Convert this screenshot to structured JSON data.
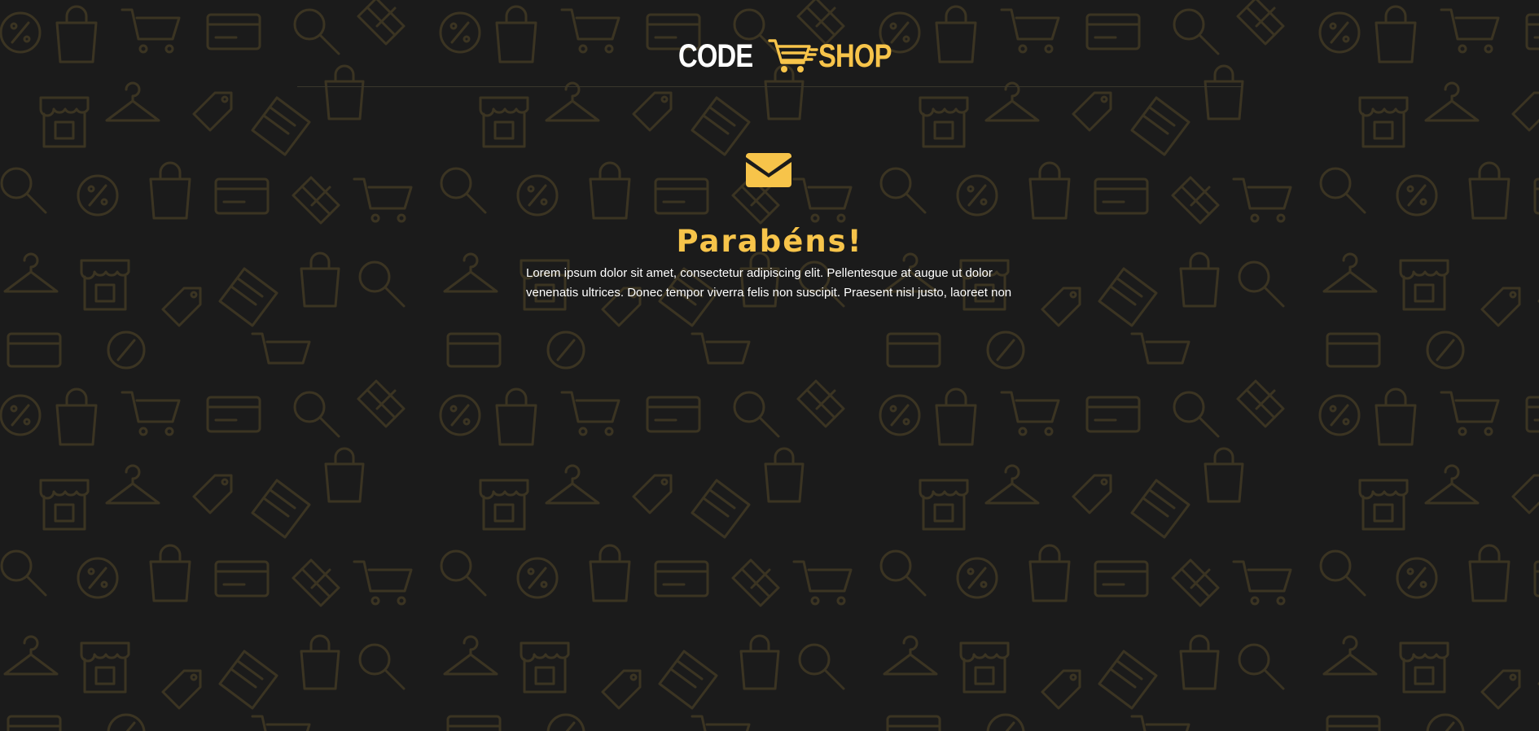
{
  "brand": {
    "word_left": "CODE",
    "word_right": "SHOP",
    "icon": "shopping-cart-icon"
  },
  "message": {
    "icon": "envelope-icon",
    "title": "Parabéns!",
    "lines": [
      "Lorem ipsum dolor sit amet, consectetur adipiscing elit. Pellentesque at augue ut dolor",
      "venenatis ultrices. Donec tempor viverra felis non suscipit. Praesent nisl justo, laoreet non"
    ]
  },
  "background": {
    "pattern_icons": [
      "shopping-bag-icon",
      "magnifier-icon",
      "discount-icon",
      "gift-icon",
      "credit-card-icon",
      "store-icon",
      "hanger-icon",
      "price-tag-icon",
      "cart-icon",
      "wallet-icon"
    ]
  },
  "colors": {
    "background": "#1b1b1b",
    "accent": "#f7c44a",
    "pattern": "#3b3422",
    "text": "#ffffff"
  }
}
